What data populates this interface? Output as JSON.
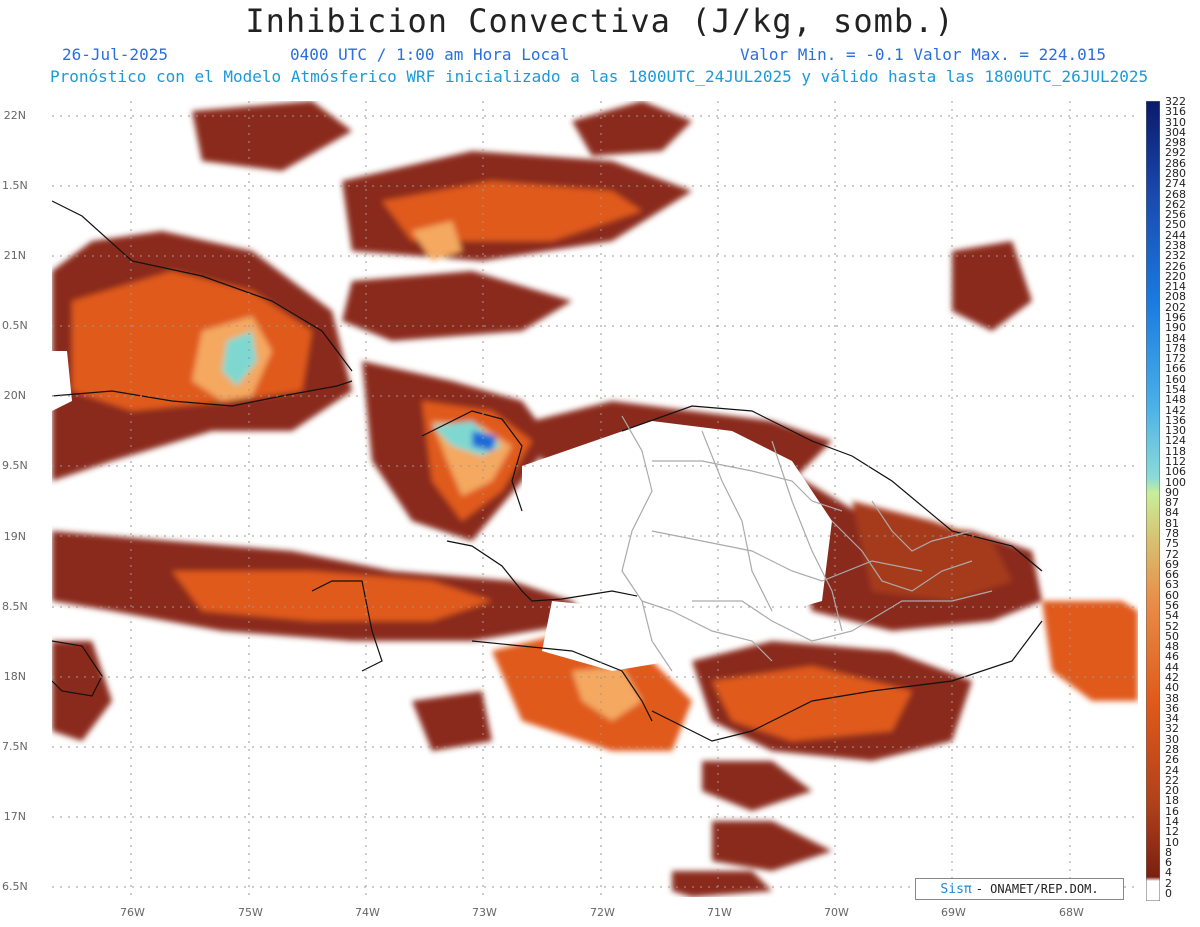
{
  "title": "Inhibicion Convectiva (J/kg, somb.)",
  "date": "26-Jul-2025",
  "time": "0400 UTC / 1:00 am Hora Local",
  "minmax": "Valor Min. = -0.1  Valor Max. = 224.015",
  "subtitle": "Pronóstico con el Modelo Atmósferico WRF inicializado a las 1800UTC_24JUL2025 y válido hasta las  1800UTC_26JUL2025",
  "lat_labels": [
    "22N",
    "1.5N",
    "21N",
    "0.5N",
    "20N",
    "9.5N",
    "19N",
    "8.5N",
    "18N",
    "7.5N",
    "17N",
    "6.5N"
  ],
  "lon_labels": [
    "76W",
    "75W",
    "74W",
    "73W",
    "72W",
    "71W",
    "70W",
    "69W",
    "68W"
  ],
  "colorbar_labels": [
    "322",
    "316",
    "310",
    "304",
    "298",
    "292",
    "286",
    "280",
    "274",
    "268",
    "262",
    "256",
    "250",
    "244",
    "238",
    "232",
    "226",
    "220",
    "214",
    "208",
    "202",
    "196",
    "190",
    "184",
    "178",
    "172",
    "166",
    "160",
    "154",
    "148",
    "142",
    "136",
    "130",
    "124",
    "118",
    "112",
    "106",
    "100",
    "90",
    "87",
    "84",
    "81",
    "78",
    "75",
    "72",
    "69",
    "66",
    "63",
    "60",
    "56",
    "54",
    "52",
    "50",
    "48",
    "46",
    "44",
    "42",
    "40",
    "38",
    "36",
    "34",
    "32",
    "30",
    "28",
    "26",
    "24",
    "22",
    "20",
    "18",
    "16",
    "14",
    "12",
    "10",
    "8",
    "6",
    "4",
    "2",
    "0"
  ],
  "credit": {
    "brand": "Sisπ",
    "text": "- ONAMET/REP.DOM."
  },
  "colors": {
    "low": "#8a2a1a",
    "mid": "#e05a1a",
    "high": "#f4a860",
    "cyan": "#7fd8d0",
    "blue": "#1a6ad8",
    "coast": "#111111",
    "border": "#aaaaaa"
  }
}
